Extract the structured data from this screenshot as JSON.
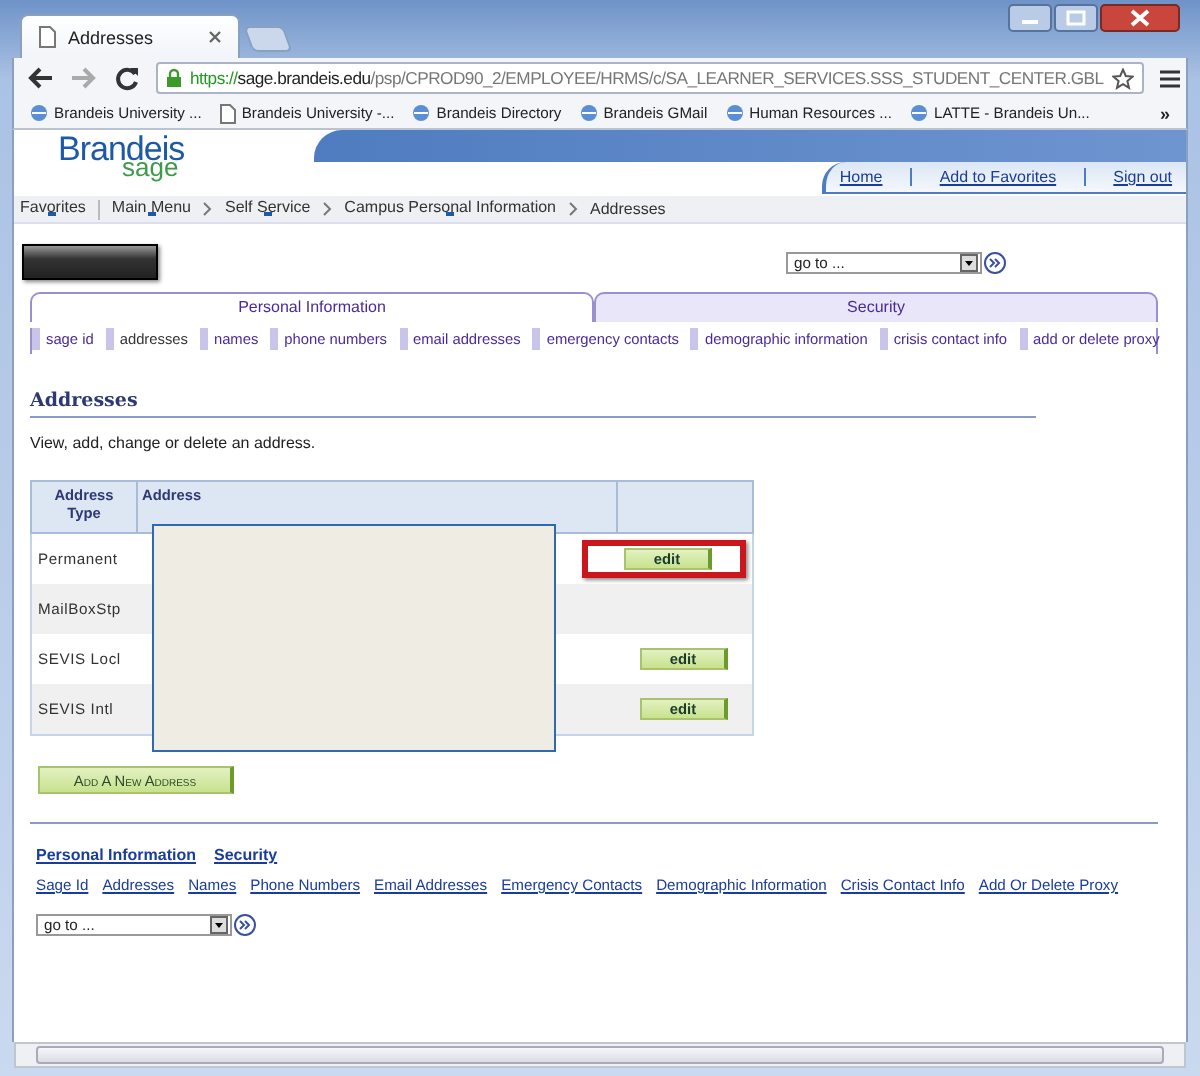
{
  "browser": {
    "tab": {
      "title": "Addresses"
    },
    "url": {
      "scheme": "https://",
      "host": "sage.brandeis.edu",
      "path": "/psp/CPROD90_2/EMPLOYEE/HRMS/c/SA_LEARNER_SERVICES.SSS_STUDENT_CENTER.GBL"
    },
    "bookmarks": [
      {
        "label": "Brandeis University ...",
        "kind": "site"
      },
      {
        "label": "Brandeis University -...",
        "kind": "page"
      },
      {
        "label": "Brandeis Directory",
        "kind": "site"
      },
      {
        "label": "Brandeis GMail",
        "kind": "site"
      },
      {
        "label": "Human Resources ...",
        "kind": "site"
      },
      {
        "label": "LATTE - Brandeis Un...",
        "kind": "site"
      }
    ],
    "more": "»"
  },
  "header": {
    "logo": "Brandeis",
    "logo_sub": "sage",
    "links": [
      "Home",
      "Add to Favorites",
      "Sign out"
    ]
  },
  "breadcrumbs": [
    {
      "label": "Favorites",
      "menu": true
    },
    {
      "label": "Main Menu",
      "menu": true
    },
    {
      "label": "Self Service",
      "menu": true
    },
    {
      "label": "Campus Personal Information",
      "menu": true
    },
    {
      "label": "Addresses",
      "menu": false
    }
  ],
  "goto": {
    "value": "go to ..."
  },
  "page_tabs": [
    {
      "label": "Personal Information",
      "selected": true
    },
    {
      "label": "Security",
      "selected": false
    }
  ],
  "sub_tabs": [
    {
      "label": "sage id",
      "selected": false
    },
    {
      "label": "addresses",
      "selected": true
    },
    {
      "label": "names",
      "selected": false
    },
    {
      "label": "phone numbers",
      "selected": false
    },
    {
      "label": "email addresses",
      "selected": false
    },
    {
      "label": "emergency contacts",
      "selected": false
    },
    {
      "label": "demographic information",
      "selected": false
    },
    {
      "label": "crisis contact info",
      "selected": false
    },
    {
      "label": "add or delete proxy",
      "selected": false
    }
  ],
  "section": {
    "title": "Addresses",
    "description": "View, add, change or delete an address."
  },
  "table": {
    "columns": [
      "Address Type",
      "Address"
    ],
    "rows": [
      {
        "address_type": "Permanent",
        "action": "edit",
        "highlighted": true
      },
      {
        "address_type": "MailBoxStp",
        "highlighted": false
      },
      {
        "address_type": "SEVIS Locl",
        "action": "edit",
        "highlighted": false
      },
      {
        "address_type": "SEVIS Intl",
        "action": "edit",
        "highlighted": false
      }
    ]
  },
  "add_button": "Add A New Address",
  "footer": {
    "tabs": [
      "Personal Information",
      "Security"
    ],
    "links": [
      "Sage Id",
      "Addresses",
      "Names",
      "Phone Numbers",
      "Email Addresses",
      "Emergency Contacts",
      "Demographic Information",
      "Crisis Contact Info",
      "Add Or Delete Proxy"
    ],
    "goto": {
      "value": "go to ..."
    }
  }
}
